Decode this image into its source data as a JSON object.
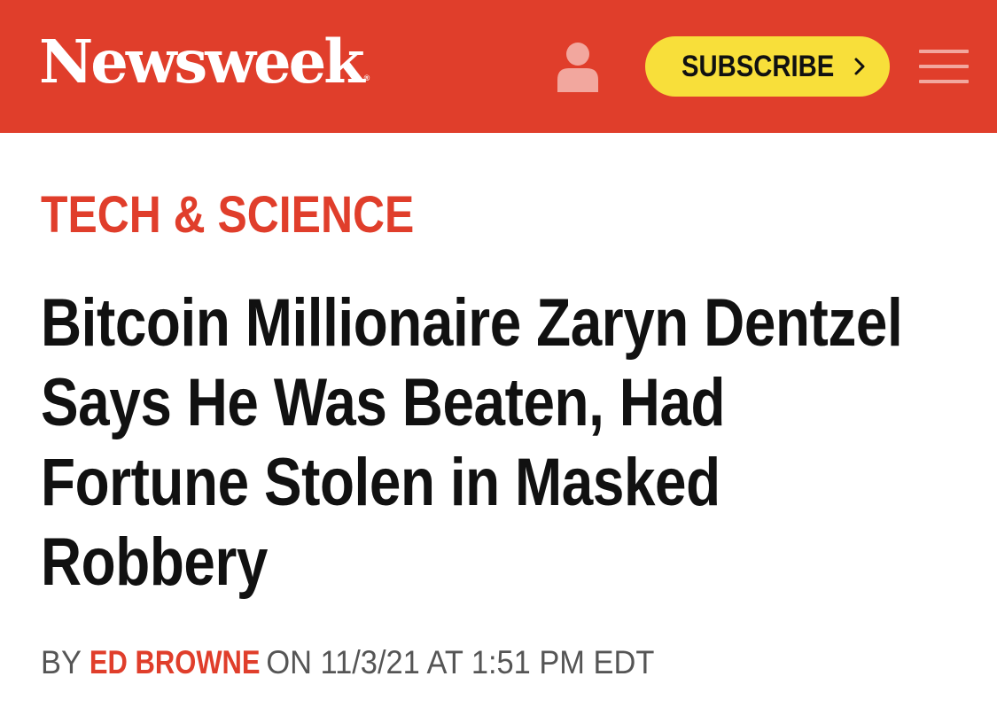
{
  "header": {
    "logo_text": "Newsweek",
    "logo_mark": "®",
    "background_color": "#e03e2b",
    "user_icon": "user-icon",
    "subscribe_label": "SUBSCRIBE",
    "subscribe_color": "#f8df3a",
    "menu_icon": "hamburger-menu-icon"
  },
  "article": {
    "section": "TECH & SCIENCE",
    "headline": "Bitcoin Millionaire Zaryn Dentzel Says He Was Beaten, Had Fortune Stolen in Masked Robbery",
    "byline": {
      "by": "BY",
      "author": "ED BROWNE",
      "on": "ON",
      "date": "11/3/21",
      "at": "AT",
      "time": "1:51 PM EDT"
    }
  }
}
